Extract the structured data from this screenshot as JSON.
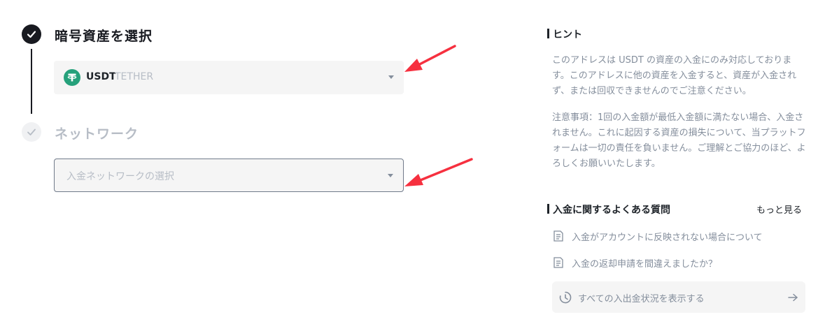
{
  "steps": {
    "step1": {
      "title": "暗号資産を選択",
      "status": "completed",
      "coin": {
        "symbol": "USDT",
        "name": "TETHER",
        "logo_color": "#26a17b"
      }
    },
    "step2": {
      "title": "ネットワーク",
      "status": "pending",
      "network_placeholder": "入金ネットワークの選択"
    }
  },
  "hint": {
    "title": "ヒント",
    "paragraphs": [
      "このアドレスは USDT の資産の入金にのみ対応しております。このアドレスに他の資産を入金すると、資産が入金されず、または回収できませんのでご注意ください。",
      "注意事項：1回の入金額が最低入金額に満たない場合、入金されません。これに起因する資産の損失について、当プラットフォームは一切の責任を負いません。ご理解とご協力のほど、よろしくお願いいたします。"
    ]
  },
  "faq": {
    "title": "入金に関するよくある質問",
    "more_label": "もっと見る",
    "items": [
      {
        "label": "入金がアカウントに反映されない場合について",
        "icon": "document-icon"
      },
      {
        "label": "入金の返却申請を間違えましたか？",
        "icon": "document-icon"
      }
    ]
  },
  "history": {
    "label": "すべての入出金状況を表示する",
    "icon": "history-icon",
    "arrow_icon": "arrow-right-icon"
  },
  "colors": {
    "primary_dark": "#181a20",
    "muted": "#848e9c",
    "disabled": "#b7bdc6",
    "field_bg": "#f5f5f5",
    "usdt_green": "#26a17b",
    "annotation_red": "#f6303f"
  }
}
